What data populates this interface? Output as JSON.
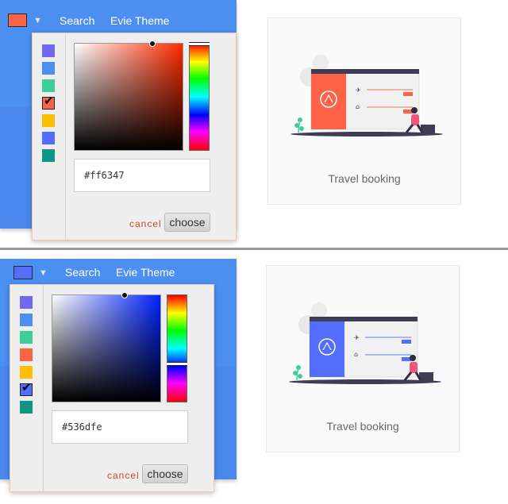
{
  "colors": {
    "nav_bar": "#4b8ff0",
    "cancel_text": "#d0452f",
    "palette": [
      "#7367f0",
      "#4b8ff0",
      "#3ccf9a",
      "#ff6347",
      "#ffbf00",
      "#536dfe",
      "#0f9488"
    ]
  },
  "top": {
    "nav": {
      "search_label": "Search",
      "theme_label": "Evie Theme"
    },
    "selected_color": "#ff6347",
    "selected_index": 3,
    "picker": {
      "hex_value": "#ff6347",
      "cancel_label": "cancel",
      "choose_label": "choose",
      "hue_color": "#ff2a00"
    },
    "card": {
      "label": "Travel booking",
      "accent": "#ff6347"
    }
  },
  "bottom": {
    "nav": {
      "search_label": "Search",
      "theme_label": "Evie Theme"
    },
    "selected_color": "#536dfe",
    "selected_index": 5,
    "picker": {
      "hex_value": "#536dfe",
      "cancel_label": "cancel",
      "choose_label": "choose",
      "hue_color": "#0022ff"
    },
    "card": {
      "label": "Travel booking",
      "accent": "#536dfe"
    }
  }
}
